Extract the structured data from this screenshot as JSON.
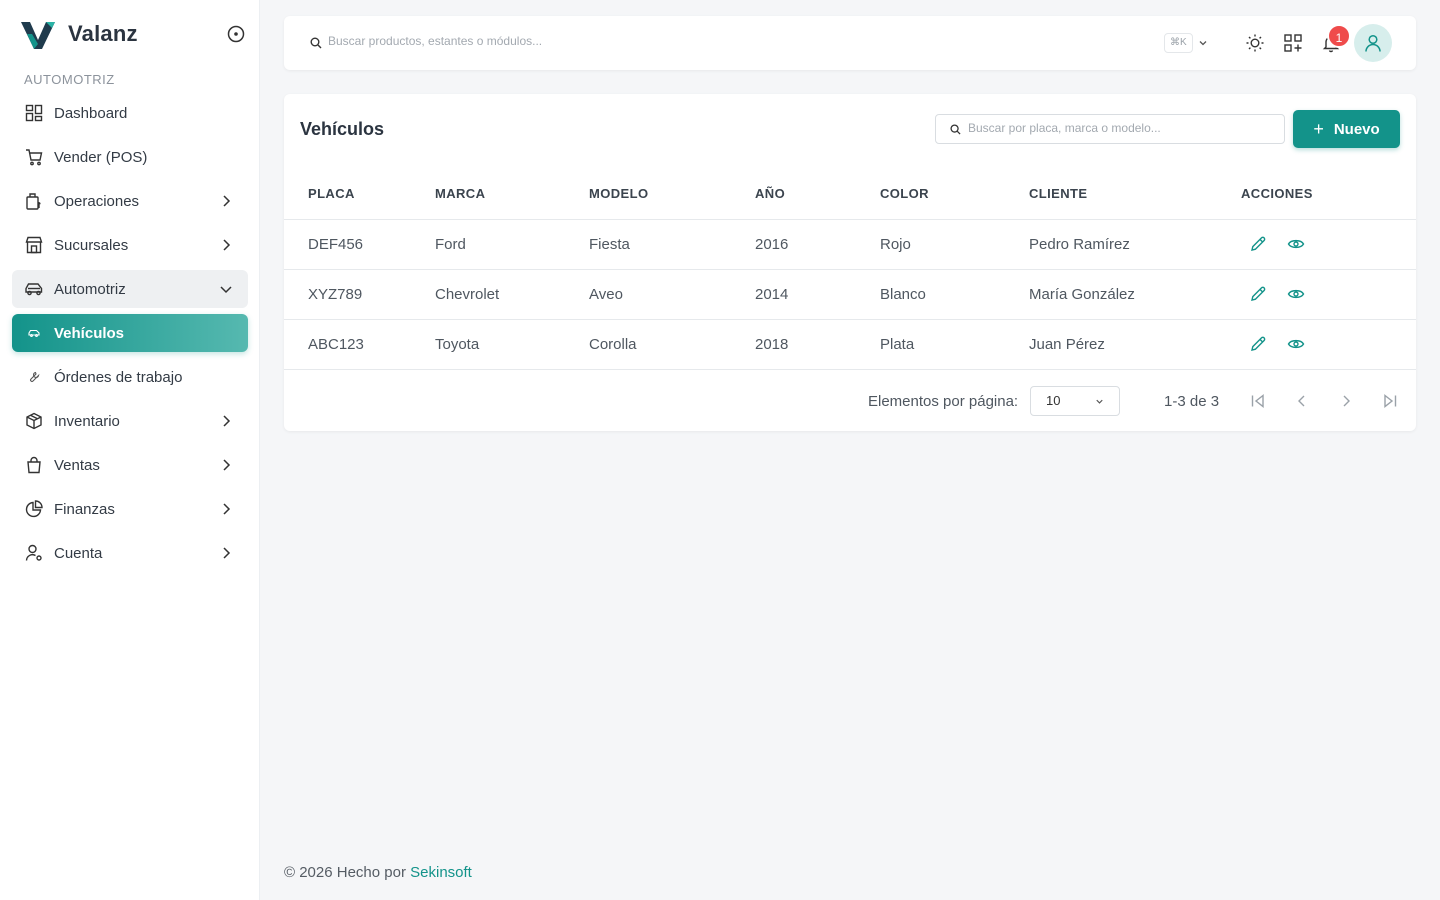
{
  "brand": {
    "name": "Valanz"
  },
  "sidebar": {
    "section": "AUTOMOTRIZ",
    "items": [
      {
        "label": "Dashboard",
        "icon": "dashboard-grid-icon"
      },
      {
        "label": "Vender (POS)",
        "icon": "cart-icon"
      },
      {
        "label": "Operaciones",
        "icon": "operations-icon"
      },
      {
        "label": "Sucursales",
        "icon": "store-icon"
      },
      {
        "label": "Automotriz",
        "icon": "car-icon"
      },
      {
        "label": "Vehículos",
        "icon": "car-small-icon"
      },
      {
        "label": "Órdenes de trabajo",
        "icon": "wrench-icon"
      },
      {
        "label": "Inventario",
        "icon": "box-icon"
      },
      {
        "label": "Ventas",
        "icon": "shopping-bag-icon"
      },
      {
        "label": "Finanzas",
        "icon": "pie-chart-icon"
      },
      {
        "label": "Cuenta",
        "icon": "user-gear-icon"
      }
    ]
  },
  "topbar": {
    "search_placeholder": "Buscar productos, estantes o módulos...",
    "shortcut": "⌘K",
    "notifications_count": "1"
  },
  "vehicles": {
    "title": "Vehículos",
    "search_placeholder": "Buscar por placa, marca o modelo...",
    "new_label": "Nuevo",
    "columns": [
      "PLACA",
      "MARCA",
      "MODELO",
      "AÑO",
      "COLOR",
      "CLIENTE",
      "ACCIONES"
    ],
    "rows": [
      [
        "DEF456",
        "Ford",
        "Fiesta",
        "2016",
        "Rojo",
        "Pedro Ramírez"
      ],
      [
        "XYZ789",
        "Chevrolet",
        "Aveo",
        "2014",
        "Blanco",
        "María González"
      ],
      [
        "ABC123",
        "Toyota",
        "Corolla",
        "2018",
        "Plata",
        "Juan Pérez"
      ]
    ],
    "pagination": {
      "per_page_label": "Elementos por página:",
      "per_page_value": "10",
      "range": "1-3 de 3"
    }
  },
  "footer": {
    "text": "© 2026 Hecho por ",
    "link": "Sekinsoft"
  },
  "colors": {
    "accent": "#13938a",
    "badge": "#ef4b4b"
  }
}
